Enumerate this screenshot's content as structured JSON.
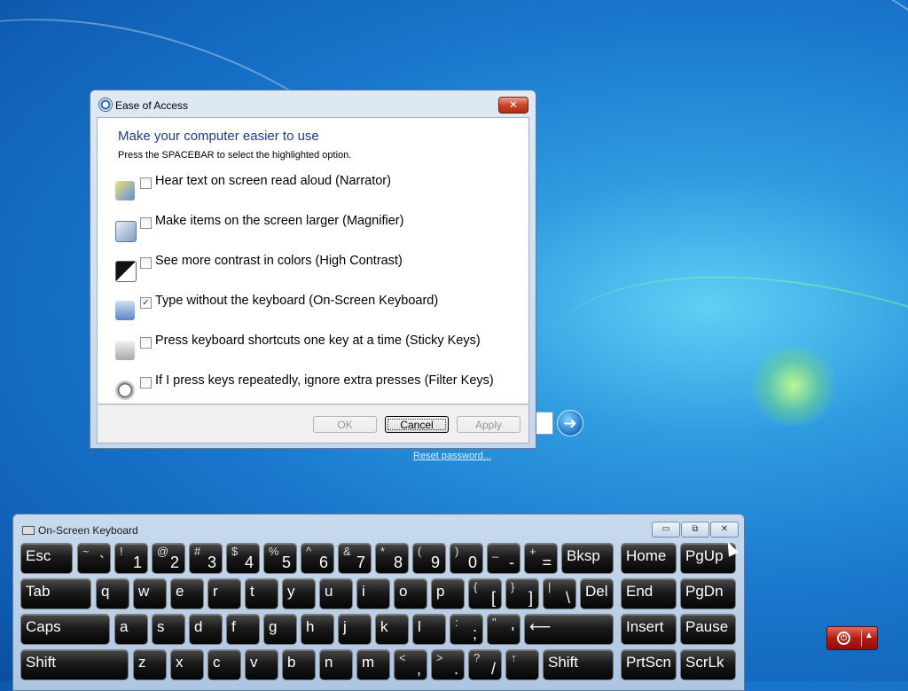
{
  "desktop": {
    "reset_link": "Reset password...",
    "go_arrow": "➔"
  },
  "dialog": {
    "title": "Ease of Access",
    "close_glyph": "✕",
    "heading": "Make your computer easier to use",
    "subtitle": "Press the SPACEBAR to select the highlighted option.",
    "options": [
      {
        "label": "Hear text on screen read aloud (Narrator)",
        "checked": false,
        "icon": "narrator-icon"
      },
      {
        "label": "Make items on the screen larger (Magnifier)",
        "checked": false,
        "icon": "magnifier-icon"
      },
      {
        "label": "See more contrast in colors (High Contrast)",
        "checked": false,
        "icon": "high-contrast-icon"
      },
      {
        "label": "Type without the keyboard (On-Screen Keyboard)",
        "checked": true,
        "icon": "keyboard-icon"
      },
      {
        "label": "Press keyboard shortcuts one key at a time (Sticky Keys)",
        "checked": false,
        "icon": "sticky-keys-icon"
      },
      {
        "label": "If I press keys repeatedly, ignore extra presses (Filter Keys)",
        "checked": false,
        "icon": "filter-keys-icon"
      }
    ],
    "ok_label": "OK",
    "cancel_label": "Cancel",
    "apply_label": "Apply"
  },
  "osk": {
    "title": "On-Screen Keyboard",
    "minimize_glyph": "▭",
    "restore_glyph": "⧉",
    "close_glyph": "✕",
    "keys": {
      "esc": "Esc",
      "tilde": {
        "top": "~",
        "bot": "`"
      },
      "1": {
        "top": "!",
        "bot": "1"
      },
      "2": {
        "top": "@",
        "bot": "2"
      },
      "3": {
        "top": "#",
        "bot": "3"
      },
      "4": {
        "top": "$",
        "bot": "4"
      },
      "5": {
        "top": "%",
        "bot": "5"
      },
      "6": {
        "top": "^",
        "bot": "6"
      },
      "7": {
        "top": "&",
        "bot": "7"
      },
      "8": {
        "top": "*",
        "bot": "8"
      },
      "9": {
        "top": "(",
        "bot": "9"
      },
      "0": {
        "top": ")",
        "bot": "0"
      },
      "minus": {
        "top": "_",
        "bot": "-"
      },
      "equal": {
        "top": "+",
        "bot": "="
      },
      "bksp": "Bksp",
      "home": "Home",
      "pgup": "PgUp",
      "tab": "Tab",
      "q": "q",
      "w": "w",
      "e": "e",
      "r": "r",
      "t": "t",
      "y": "y",
      "u": "u",
      "i": "i",
      "o": "o",
      "p": "p",
      "lbracket": {
        "top": "{",
        "bot": "["
      },
      "rbracket": {
        "top": "}",
        "bot": "]"
      },
      "backslash": {
        "top": "|",
        "bot": "\\"
      },
      "del": "Del",
      "end": "End",
      "pgdn": "PgDn",
      "caps": "Caps",
      "a": "a",
      "s": "s",
      "d": "d",
      "f": "f",
      "g": "g",
      "h": "h",
      "j": "j",
      "k": "k",
      "l": "l",
      "semicolon": {
        "top": ":",
        "bot": ";"
      },
      "quote": {
        "top": "\"",
        "bot": "'"
      },
      "enter": "⟵",
      "insert": "Insert",
      "pause": "Pause",
      "shift_l": "Shift",
      "z": "z",
      "x": "x",
      "c": "c",
      "v": "v",
      "b": "b",
      "n": "n",
      "m": "m",
      "comma": {
        "top": "<",
        "bot": ","
      },
      "period": {
        "top": ">",
        "bot": "."
      },
      "slash": {
        "top": "?",
        "bot": "/"
      },
      "up": "↑",
      "shift_r": "Shift",
      "prtscn": "PrtScn",
      "scrlk": "ScrLk"
    }
  },
  "power": {
    "power_glyph": "⏻",
    "menu_glyph": "▲"
  }
}
